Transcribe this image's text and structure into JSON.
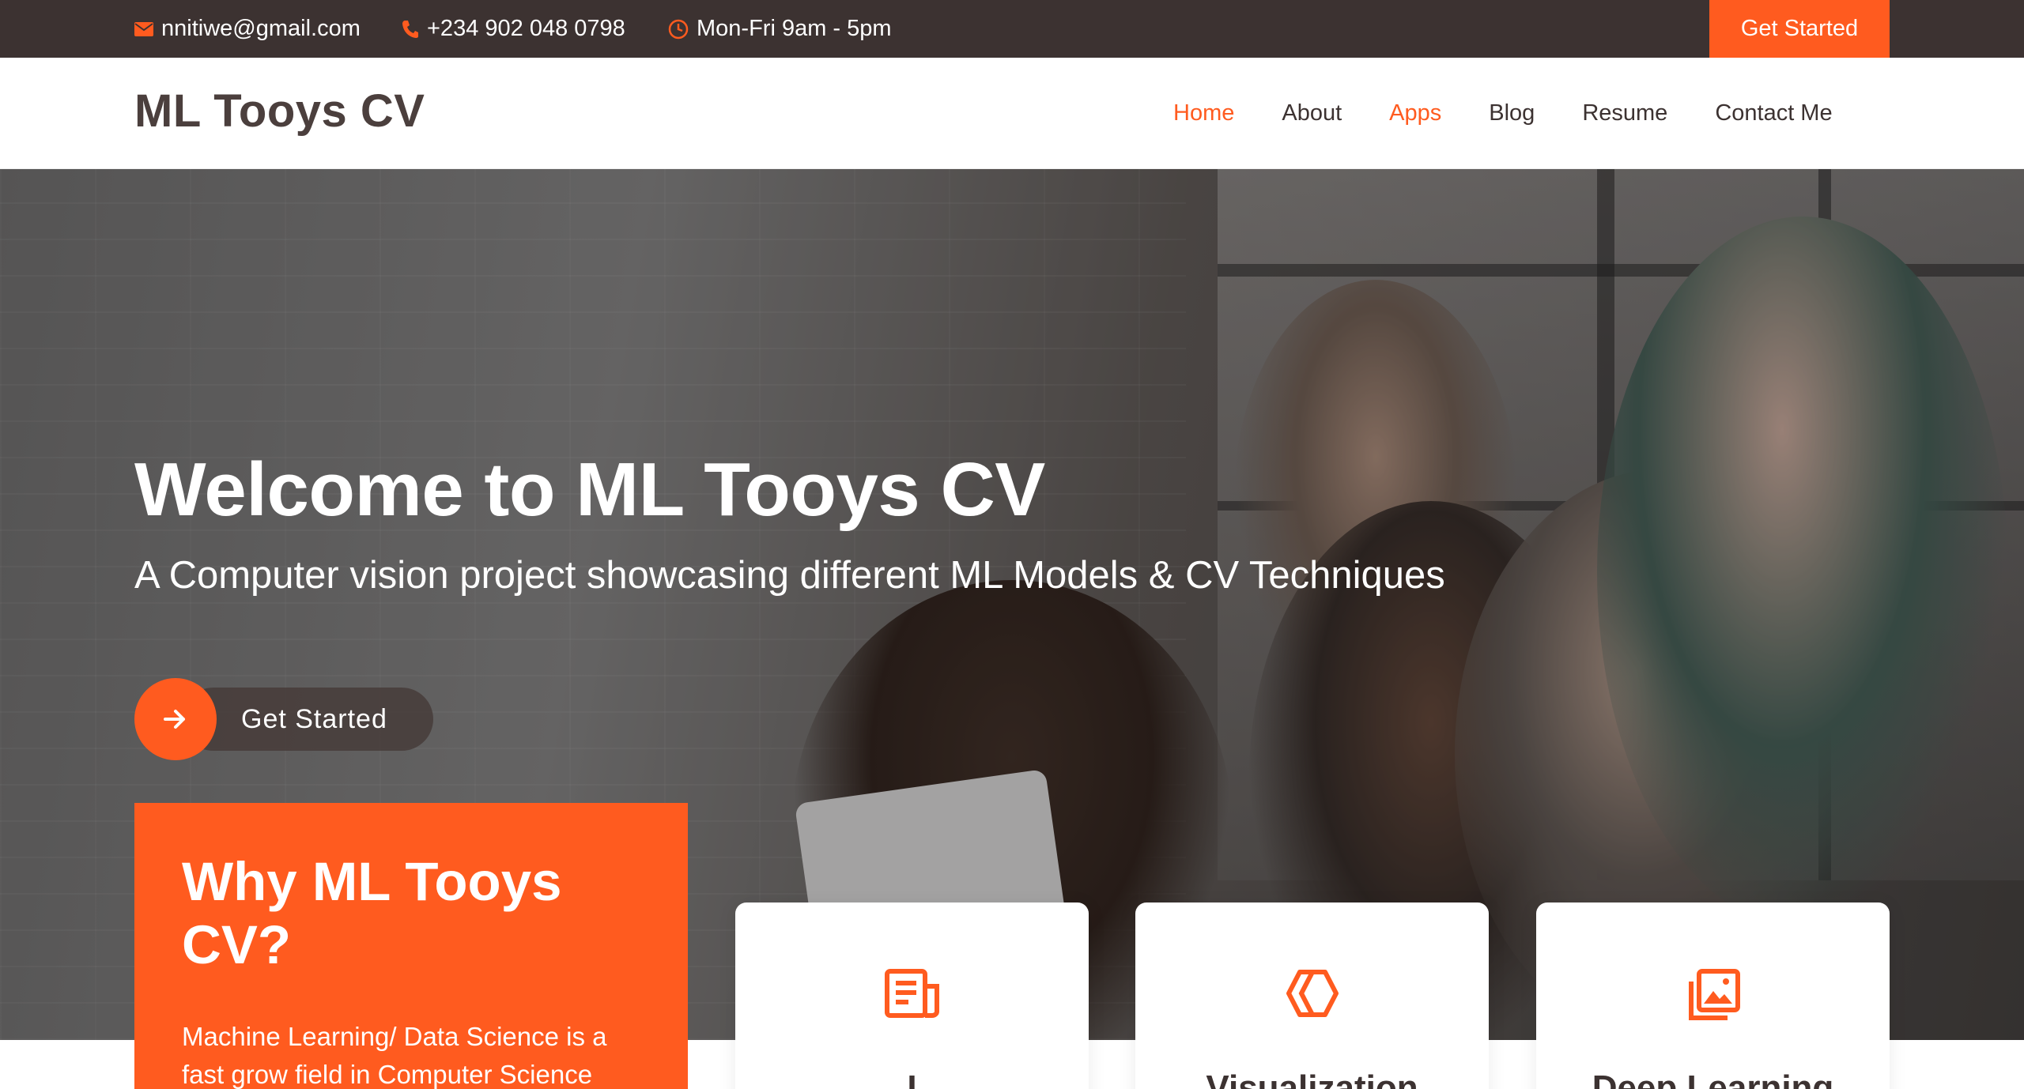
{
  "topbar": {
    "email": "nnitiwe@gmail.com",
    "phone": "+234 902 048 0798",
    "hours": "Mon-Fri 9am - 5pm",
    "cta_label": "Get Started",
    "icons": [
      "envelope-icon",
      "phone-icon",
      "clock-icon"
    ]
  },
  "header": {
    "brand": "ML Tooys CV",
    "nav": [
      {
        "label": "Home",
        "active": true
      },
      {
        "label": "About",
        "active": false
      },
      {
        "label": "Apps",
        "active": true
      },
      {
        "label": "Blog",
        "active": false
      },
      {
        "label": "Resume",
        "active": false
      },
      {
        "label": "Contact Me",
        "active": false
      }
    ]
  },
  "hero": {
    "title": "Welcome to ML Tooys CV",
    "subtitle": "A Computer vision project showcasing different ML Models & CV Techniques",
    "button_label": "Get Started",
    "button_icon": "arrow-right-icon"
  },
  "why": {
    "heading": "Why ML Tooys CV?",
    "text": "Machine Learning/ Data Science is a fast grow field in Computer Science"
  },
  "cards": [
    {
      "title": "I",
      "icon": "document-icon"
    },
    {
      "title": "Visualization",
      "icon": "cube-icon"
    },
    {
      "title": "Deep Learning",
      "icon": "images-icon"
    }
  ],
  "colors": {
    "accent": "#ff5b1f",
    "topbar": "#3c3231",
    "text_dark": "#3c3231"
  }
}
